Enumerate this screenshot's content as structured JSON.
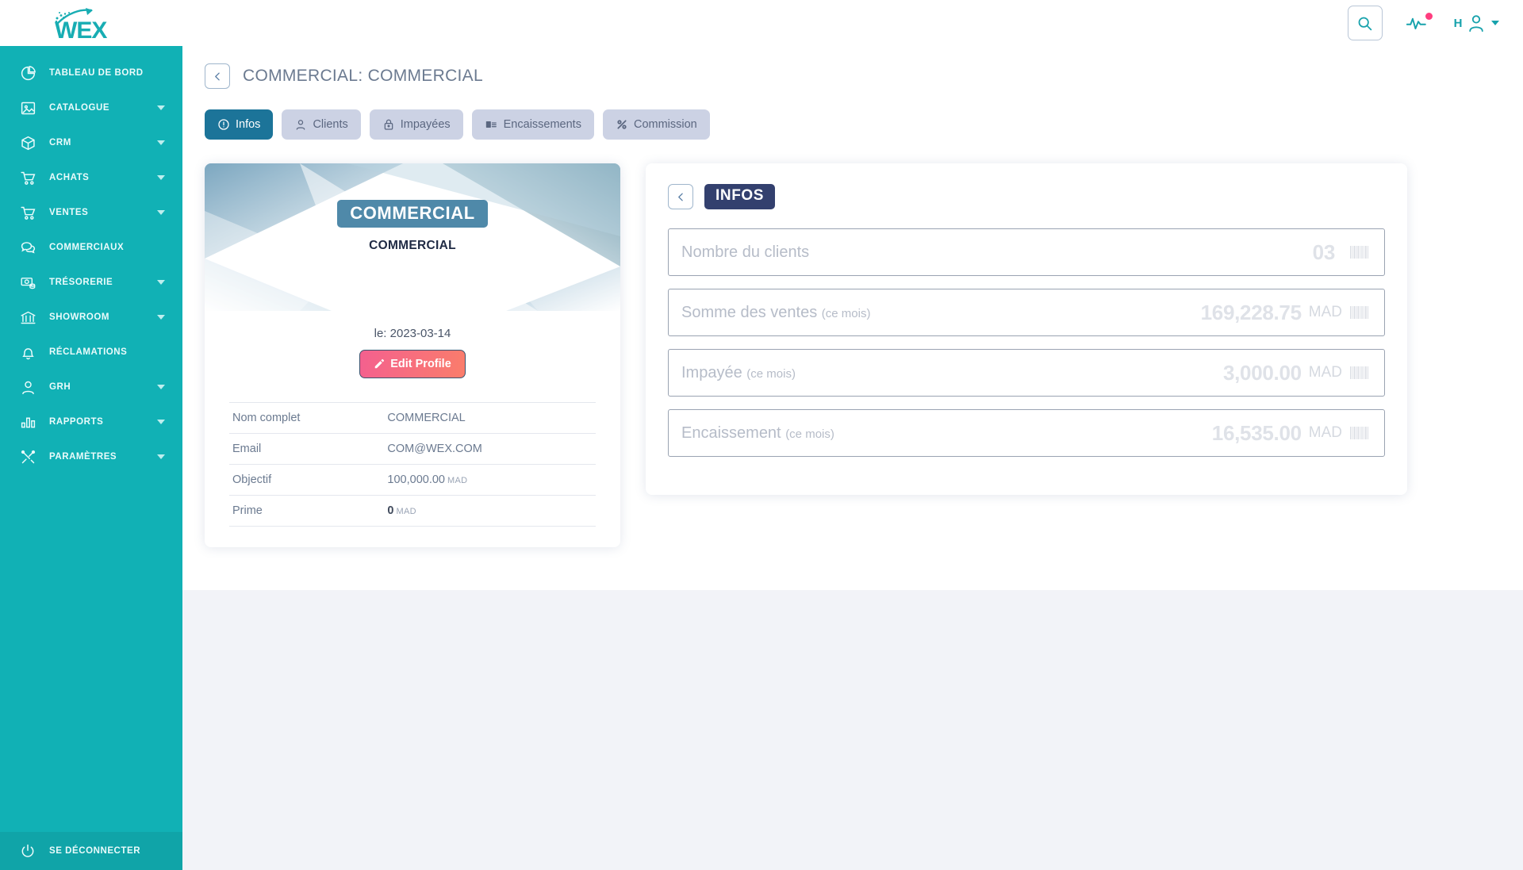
{
  "brand": {
    "name": "WEX",
    "accent": "#17a2ac",
    "sidebar_color": "#11b1b5"
  },
  "topbar": {
    "search_icon": "search-icon",
    "activity_icon": "activity-pulse-icon",
    "activity_badge_color": "#ff3d7f",
    "user_initial": "H",
    "user_icon": "user-icon",
    "user_caret_icon": "chevron-down-icon"
  },
  "sidebar": {
    "items": [
      {
        "label": "TABLEAU DE BORD",
        "icon": "pie-chart-icon",
        "has_submenu": false
      },
      {
        "label": "CATALOGUE",
        "icon": "image-icon",
        "has_submenu": true
      },
      {
        "label": "CRM",
        "icon": "cube-icon",
        "has_submenu": true
      },
      {
        "label": "ACHATS",
        "icon": "cart-icon",
        "has_submenu": true
      },
      {
        "label": "VENTES",
        "icon": "cart-icon",
        "has_submenu": true
      },
      {
        "label": "COMMERCIAUX",
        "icon": "chat-bubbles-icon",
        "has_submenu": false
      },
      {
        "label": "TRÉSORERIE",
        "icon": "money-icon",
        "has_submenu": true
      },
      {
        "label": "SHOWROOM",
        "icon": "bank-icon",
        "has_submenu": true
      },
      {
        "label": "RÉCLAMATIONS",
        "icon": "bell-icon",
        "has_submenu": false
      },
      {
        "label": "GRH",
        "icon": "person-icon",
        "has_submenu": true
      },
      {
        "label": "RAPPORTS",
        "icon": "bar-chart-icon",
        "has_submenu": true
      },
      {
        "label": "PARAMÈTRES",
        "icon": "tools-icon",
        "has_submenu": true
      }
    ],
    "logout": {
      "label": "SE DÉCONNECTER",
      "icon": "power-icon"
    }
  },
  "page": {
    "back_icon": "chevron-left-icon",
    "title": "COMMERCIAL: COMMERCIAL"
  },
  "tabs": [
    {
      "label": "Infos",
      "icon": "info-circle-icon",
      "active": true
    },
    {
      "label": "Clients",
      "icon": "user-icon",
      "active": false
    },
    {
      "label": "Impayées",
      "icon": "lock-icon",
      "active": false
    },
    {
      "label": "Encaissements",
      "icon": "cash-stack-icon",
      "active": false
    },
    {
      "label": "Commission",
      "icon": "percent-icon",
      "active": false
    }
  ],
  "profile": {
    "banner_name": "COMMERCIAL",
    "display_name": "COMMERCIAL",
    "date_line": "le: 2023-03-14",
    "edit_button": {
      "label": "Edit Profile",
      "icon": "pencil-icon"
    },
    "details": [
      {
        "label": "Nom complet",
        "value": "COMMERCIAL",
        "unit": "",
        "bold": false
      },
      {
        "label": "Email",
        "value": "COM@WEX.COM",
        "unit": "",
        "bold": false
      },
      {
        "label": "Objectif",
        "value": "100,000.00",
        "unit": "MAD",
        "bold": false
      },
      {
        "label": "Prime",
        "value": "0",
        "unit": "MAD",
        "bold": true
      }
    ]
  },
  "infos": {
    "back_icon": "chevron-left-icon",
    "badge": "INFOS",
    "stats": [
      {
        "label": "Nombre du clients",
        "period": "",
        "value": "03",
        "unit": "",
        "icon": "barcode-icon"
      },
      {
        "label": "Somme des ventes",
        "period": "(ce mois)",
        "value": "169,228.75",
        "unit": "MAD",
        "icon": "barcode-icon"
      },
      {
        "label": "Impayée",
        "period": "(ce mois)",
        "value": "3,000.00",
        "unit": "MAD",
        "icon": "barcode-icon"
      },
      {
        "label": "Encaissement",
        "period": "(ce mois)",
        "value": "16,535.00",
        "unit": "MAD",
        "icon": "barcode-icon"
      }
    ]
  }
}
